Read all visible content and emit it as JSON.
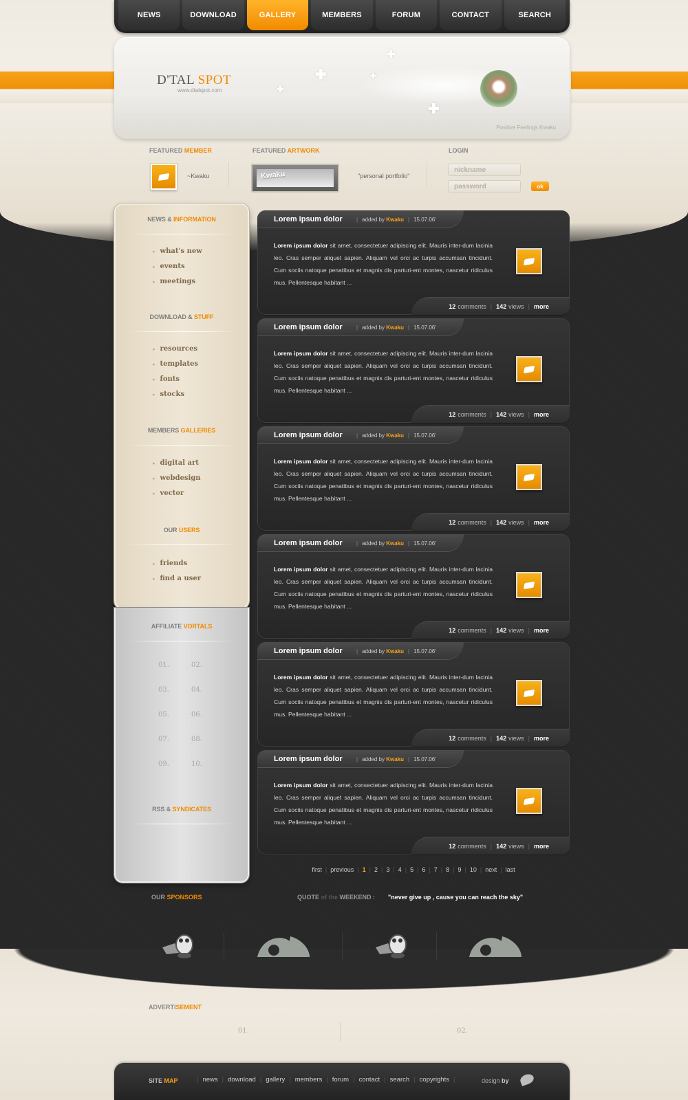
{
  "nav": {
    "items": [
      {
        "label": "NEWS"
      },
      {
        "label": "DOWNLOAD"
      },
      {
        "label": "GALLERY"
      },
      {
        "label": "MEMBERS"
      },
      {
        "label": "FORUM"
      },
      {
        "label": "CONTACT"
      },
      {
        "label": "SEARCH"
      }
    ],
    "active": "GALLERY"
  },
  "banner": {
    "logo_main": "D'TAL",
    "logo_accent": "SPOT",
    "url": "www.dtalspot.com",
    "caption": "Positive Feelings   Kwaku"
  },
  "featured": {
    "member_title": "FEATURED",
    "member_title_accent": "MEMBER",
    "member_name": "~Kwaku",
    "artwork_title": "FEATURED",
    "artwork_title_accent": "ARTWORK",
    "artwork_label": "Kwaku",
    "artwork_caption": "\"personal portfolio\"",
    "login_title": "LOGIN",
    "nickname_placeholder": "nickname",
    "password_placeholder": "password",
    "ok_label": "ok"
  },
  "sidebar": {
    "news": {
      "title": "NEWS &",
      "title_accent": "INFORMATION",
      "links": [
        "what's new",
        "events",
        "meetings"
      ]
    },
    "download": {
      "title": "DOWNLOAD &",
      "title_accent": "STUFF",
      "links": [
        "resources",
        "templates",
        "fonts",
        "stocks"
      ]
    },
    "galleries": {
      "title": "MEMBERS",
      "title_accent": "GALLERIES",
      "links": [
        "digital art",
        "webdesign",
        "vector"
      ]
    },
    "users": {
      "title": "OUR",
      "title_accent": "USERS",
      "links": [
        "friends",
        "find a user"
      ]
    },
    "affiliate": {
      "title": "AFFILIATE",
      "title_accent": "VORTALS",
      "numbers": [
        "01.",
        "02.",
        "03.",
        "04.",
        "05.",
        "06.",
        "07.",
        "08.",
        "09.",
        "10."
      ]
    },
    "rss": {
      "title": "RSS &",
      "title_accent": "SYNDICATES"
    }
  },
  "posts": [
    {
      "title": "Lorem ipsum dolor",
      "added_by": "added by",
      "author": "Kwaku",
      "date": "15.07.06'",
      "lead": "Lorem ipsum dolor",
      "body": " sit amet, consectetuer adipiscing elit. Mauris inter-dum lacinia leo. Cras semper aliquet sapien. Aliquam vel orci ac turpis accumsan tincidunt. Cum sociis natoque penatibus et magnis dis parturi-ent montes, nascetur ridiculus mus. Pellentesque habitant ...",
      "comments": "12",
      "comments_label": "comments",
      "views": "142",
      "views_label": "views",
      "more": "more"
    },
    {
      "title": "Lorem ipsum dolor",
      "added_by": "added by",
      "author": "Kwaku",
      "date": "15.07.06'",
      "lead": "Lorem ipsum dolor",
      "body": " sit amet, consectetuer adipiscing elit. Mauris inter-dum lacinia leo. Cras semper aliquet sapien. Aliquam vel orci ac turpis accumsan tincidunt. Cum sociis natoque penatibus et magnis dis parturi-ent montes, nascetur ridiculus mus. Pellentesque habitant ...",
      "comments": "12",
      "comments_label": "comments",
      "views": "142",
      "views_label": "views",
      "more": "more"
    },
    {
      "title": "Lorem ipsum dolor",
      "added_by": "added by",
      "author": "Kwaku",
      "date": "15.07.06'",
      "lead": "Lorem ipsum dolor",
      "body": " sit amet, consectetuer adipiscing elit. Mauris inter-dum lacinia leo. Cras semper aliquet sapien. Aliquam vel orci ac turpis accumsan tincidunt. Cum sociis natoque penatibus et magnis dis parturi-ent montes, nascetur ridiculus mus. Pellentesque habitant ...",
      "comments": "12",
      "comments_label": "comments",
      "views": "142",
      "views_label": "views",
      "more": "more"
    },
    {
      "title": "Lorem ipsum dolor",
      "added_by": "added by",
      "author": "Kwaku",
      "date": "15.07.06'",
      "lead": "Lorem ipsum dolor",
      "body": " sit amet, consectetuer adipiscing elit. Mauris inter-dum lacinia leo. Cras semper aliquet sapien. Aliquam vel orci ac turpis accumsan tincidunt. Cum sociis natoque penatibus et magnis dis parturi-ent montes, nascetur ridiculus mus. Pellentesque habitant ...",
      "comments": "12",
      "comments_label": "comments",
      "views": "142",
      "views_label": "views",
      "more": "more"
    },
    {
      "title": "Lorem ipsum dolor",
      "added_by": "added by",
      "author": "Kwaku",
      "date": "15.07.06'",
      "lead": "Lorem ipsum dolor",
      "body": " sit amet, consectetuer adipiscing elit. Mauris inter-dum lacinia leo. Cras semper aliquet sapien. Aliquam vel orci ac turpis accumsan tincidunt. Cum sociis natoque penatibus et magnis dis parturi-ent montes, nascetur ridiculus mus. Pellentesque habitant ...",
      "comments": "12",
      "comments_label": "comments",
      "views": "142",
      "views_label": "views",
      "more": "more"
    },
    {
      "title": "Lorem ipsum dolor",
      "added_by": "added by",
      "author": "Kwaku",
      "date": "15.07.06'",
      "lead": "Lorem ipsum dolor",
      "body": " sit amet, consectetuer adipiscing elit. Mauris inter-dum lacinia leo. Cras semper aliquet sapien. Aliquam vel orci ac turpis accumsan tincidunt. Cum sociis natoque penatibus et magnis dis parturi-ent montes, nascetur ridiculus mus. Pellentesque habitant ...",
      "comments": "12",
      "comments_label": "comments",
      "views": "142",
      "views_label": "views",
      "more": "more"
    }
  ],
  "pager": {
    "first": "first",
    "previous": "previous",
    "pages": [
      "1",
      "2",
      "3",
      "4",
      "5",
      "6",
      "7",
      "8",
      "9",
      "10"
    ],
    "current": "1",
    "next": "next",
    "last": "last"
  },
  "sponsors": {
    "title": "OUR",
    "title_accent": "SPONSORS",
    "logos": [
      "penguin-logo-icon",
      "deviantart-logo-icon",
      "penguin-logo-icon",
      "deviantart-logo-icon"
    ]
  },
  "quote": {
    "title_1": "QUOTE",
    "title_dim": "of the",
    "title_2": "WEEKEND :",
    "text": "\"never give up , cause you can reach the sky\""
  },
  "ad": {
    "title": "ADVERTI",
    "title_accent": "SEMENT",
    "slots": [
      "01.",
      "02."
    ]
  },
  "footer": {
    "site_label": "SITE",
    "site_accent": "MAP",
    "links": [
      "news",
      "download",
      "gallery",
      "members",
      "forum",
      "contact",
      "search",
      "copyrights"
    ],
    "design_by": "design",
    "design_by_bold": "by"
  },
  "colors": {
    "accent": "#f08a00",
    "dark_bg": "#2a2a2a",
    "beige": "#ebe5d9"
  }
}
